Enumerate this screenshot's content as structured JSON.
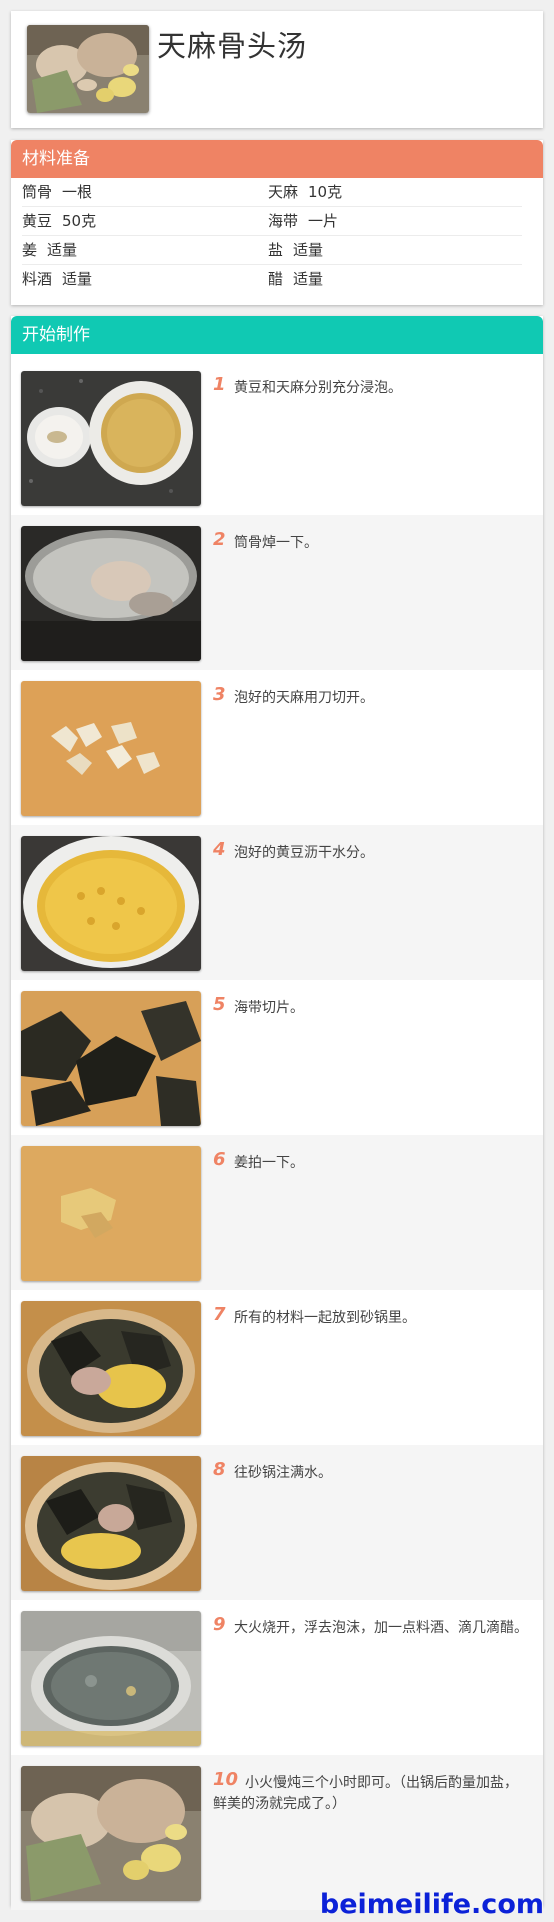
{
  "recipe": {
    "title": "天麻骨头汤"
  },
  "ingredients": {
    "header": "材料准备",
    "items": [
      {
        "name": "筒骨",
        "amount": "一根"
      },
      {
        "name": "天麻",
        "amount": "10克"
      },
      {
        "name": "黄豆",
        "amount": "50克"
      },
      {
        "name": "海带",
        "amount": "一片"
      },
      {
        "name": "姜",
        "amount": "适量"
      },
      {
        "name": "盐",
        "amount": "适量"
      },
      {
        "name": "料酒",
        "amount": "适量"
      },
      {
        "name": "醋",
        "amount": "适量"
      }
    ]
  },
  "steps": {
    "header": "开始制作",
    "items": [
      {
        "num": "1",
        "text": "黄豆和天麻分别充分浸泡。"
      },
      {
        "num": "2",
        "text": "筒骨焯一下。"
      },
      {
        "num": "3",
        "text": "泡好的天麻用刀切开。"
      },
      {
        "num": "4",
        "text": "泡好的黄豆沥干水分。"
      },
      {
        "num": "5",
        "text": "海带切片。"
      },
      {
        "num": "6",
        "text": "姜拍一下。"
      },
      {
        "num": "7",
        "text": "所有的材料一起放到砂锅里。"
      },
      {
        "num": "8",
        "text": "往砂锅注满水。"
      },
      {
        "num": "9",
        "text": "大火烧开，浮去泡沫，加一点料酒、滴几滴醋。"
      },
      {
        "num": "10",
        "text": "小火慢炖三个小时即可。（出锅后酌量加盐，鲜美的汤就完成了。）"
      }
    ]
  },
  "watermark": "beimeilife.com",
  "colors": {
    "ingredients_header": "#ef8364",
    "steps_header": "#10c9b3",
    "step_number": "#ef8364",
    "watermark": "#0b21d8"
  }
}
